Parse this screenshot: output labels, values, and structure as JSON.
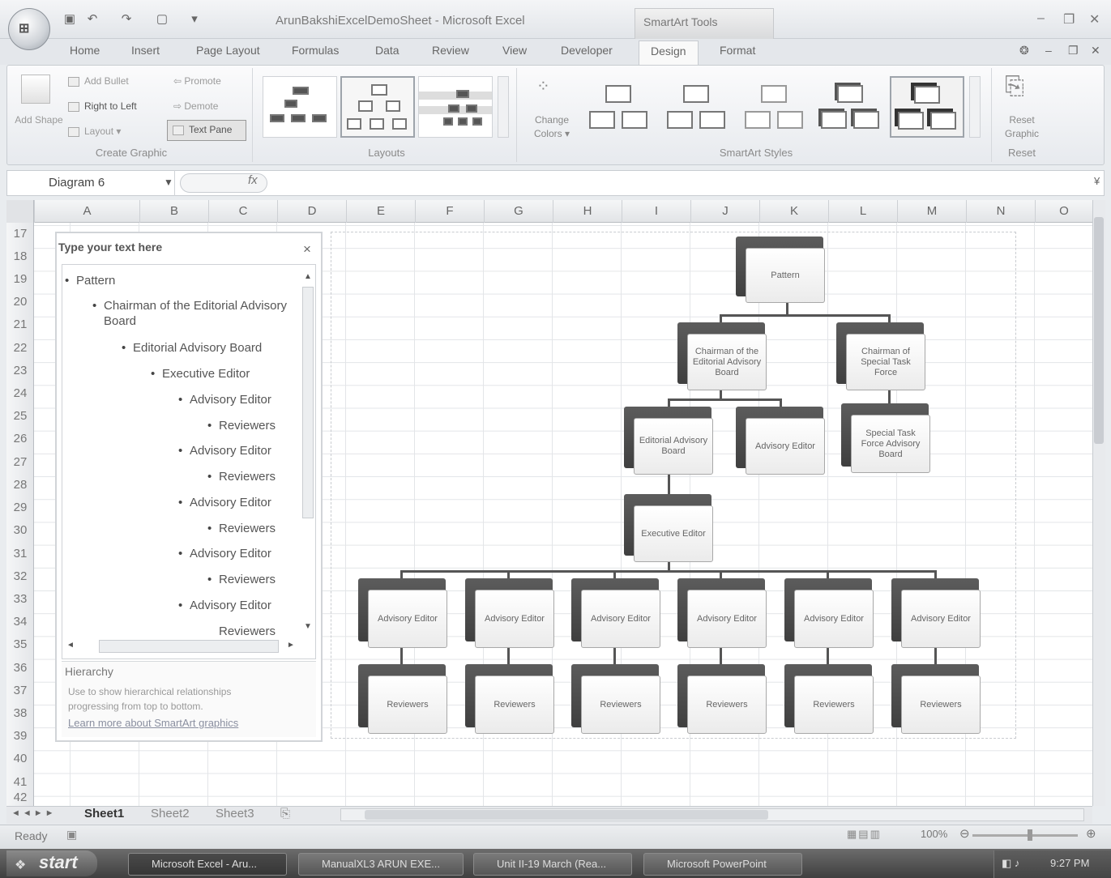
{
  "window": {
    "title": "ArunBakshiExcelDemoSheet - Microsoft Excel",
    "contextual_group": "SmartArt Tools"
  },
  "tabs": [
    "Home",
    "Insert",
    "Page Layout",
    "Formulas",
    "Data",
    "Review",
    "View",
    "Developer",
    "Design",
    "Format"
  ],
  "ribbon": {
    "create_graphic": {
      "label": "Create Graphic",
      "add_shape": "Add Shape",
      "add_bullet": "Add Bullet",
      "right_to_left": "Right to Left",
      "layout": "Layout",
      "promote": "Promote",
      "demote": "Demote",
      "text_pane": "Text Pane"
    },
    "layouts": {
      "label": "Layouts"
    },
    "change_colors": "Change Colors",
    "smartart_styles": {
      "label": "SmartArt Styles"
    },
    "reset": {
      "label": "Reset",
      "reset_graphic": "Reset Graphic"
    }
  },
  "formula_bar": {
    "name_box": "Diagram 6",
    "fx": "fx"
  },
  "columns": [
    "A",
    "B",
    "C",
    "D",
    "E",
    "F",
    "G",
    "H",
    "I",
    "J",
    "K",
    "L",
    "M",
    "N",
    "O"
  ],
  "rows": [
    "17",
    "18",
    "19",
    "20",
    "21",
    "22",
    "23",
    "24",
    "25",
    "26",
    "27",
    "28",
    "29",
    "30",
    "31",
    "32",
    "33",
    "34",
    "35",
    "36",
    "37",
    "38",
    "39",
    "40",
    "41",
    "42"
  ],
  "text_pane": {
    "title": "Type your text here",
    "close": "×",
    "items": [
      "Pattern",
      "Chairman of the Editorial Advisory Board",
      "Editorial Advisory Board",
      "Executive Editor",
      "Advisory Editor",
      "Reviewers",
      "Advisory Editor",
      "Reviewers",
      "Advisory Editor",
      "Reviewers",
      "Advisory Editor",
      "Reviewers",
      "Advisory Editor",
      "Reviewers"
    ],
    "info_title": "Hierarchy",
    "info_desc": "Use to show hierarchical relationships progressing from top to bottom.",
    "info_link": "Learn more about SmartArt graphics"
  },
  "diagram": {
    "root": "Pattern",
    "chairman_editorial": "Chairman of the Editorial Advisory Board",
    "chairman_special": "Chairman of Special Task Force",
    "editorial_board": "Editorial Advisory Board",
    "advisory_editor_top": "Advisory Editor",
    "special_board": "Special Task Force Advisory Board",
    "executive_editor": "Executive Editor",
    "advisory_editor": "Advisory Editor",
    "reviewers": "Reviewers"
  },
  "sheets": [
    "Sheet1",
    "Sheet2",
    "Sheet3"
  ],
  "status": {
    "ready": "Ready",
    "zoom": "100%"
  },
  "taskbar": {
    "start": "start",
    "items": [
      "Microsoft Excel - Aru...",
      "ManualXL3 ARUN EXE...",
      "Unit II-19 March (Rea...",
      "Microsoft PowerPoint"
    ],
    "clock": "9:27 PM"
  }
}
